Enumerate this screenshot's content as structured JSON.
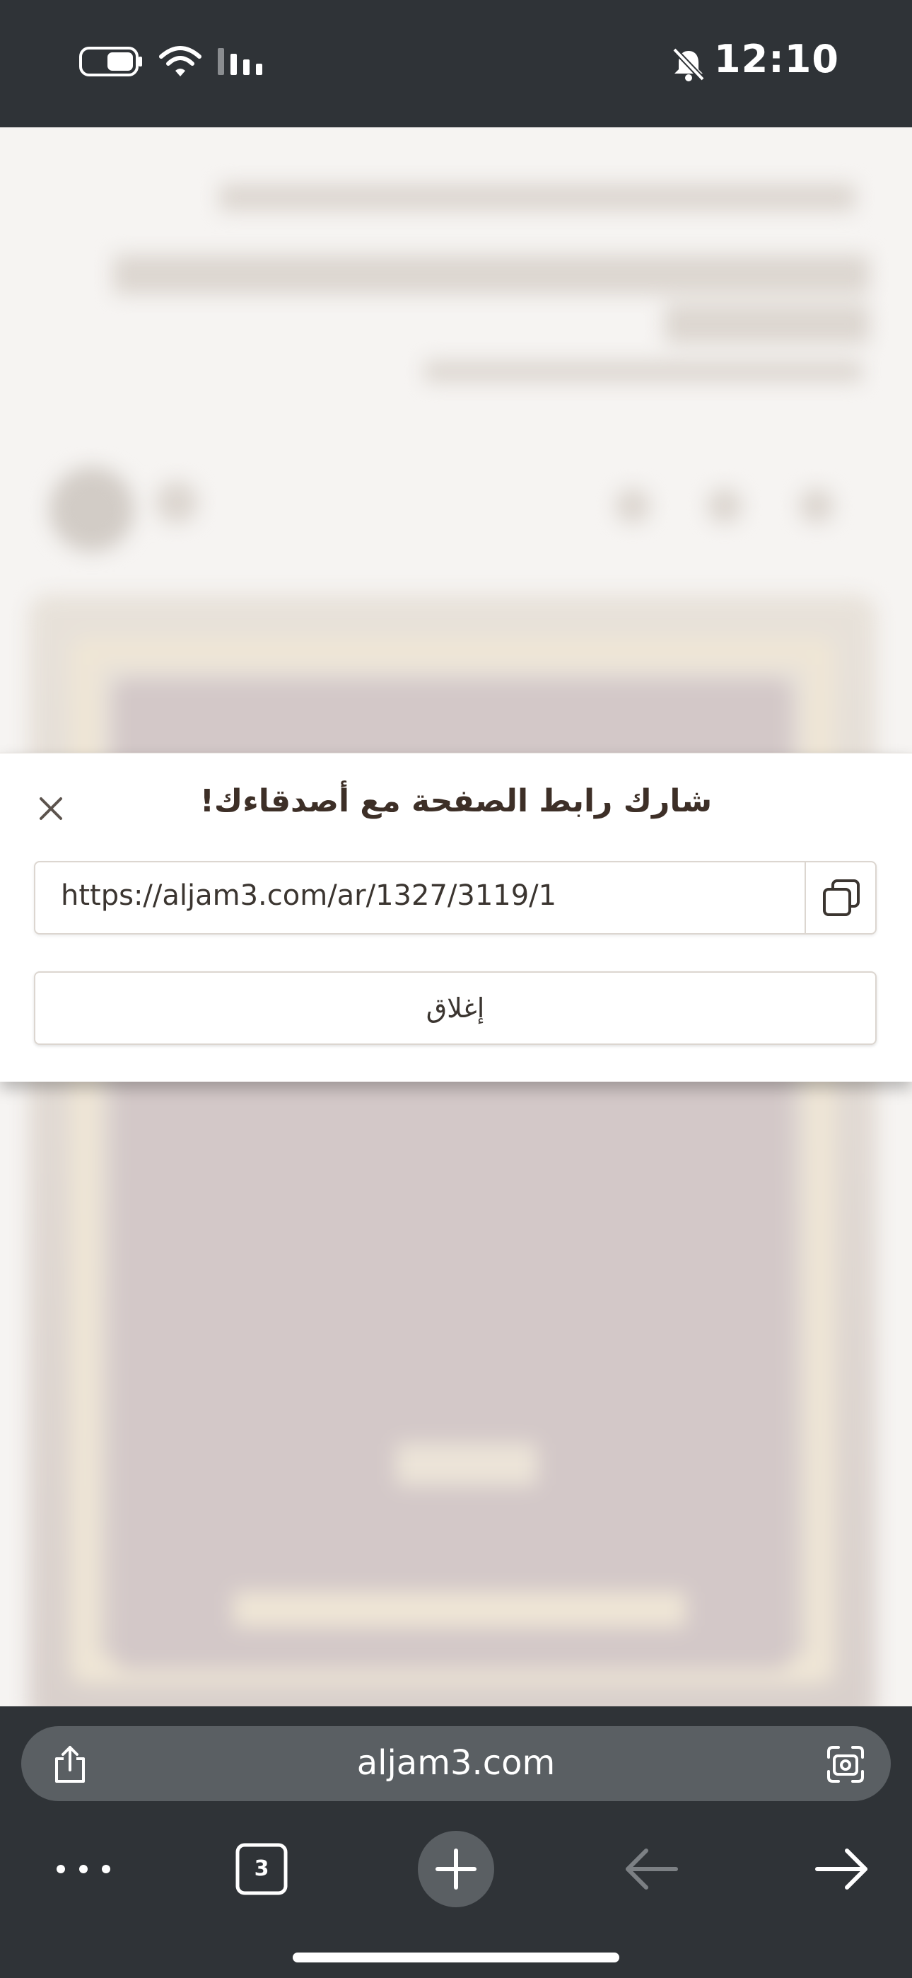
{
  "status_bar": {
    "time": "12:10",
    "icons": [
      "battery-icon",
      "wifi-icon",
      "signal-icon",
      "bell-slash-icon"
    ]
  },
  "share_dialog": {
    "title": "شارك رابط الصفحة مع أصدقاءك!",
    "url_value": "https://aljam3.com/ar/1327/3119/1",
    "close_label": "إغلاق",
    "icons": [
      "close-icon",
      "copy-icon"
    ]
  },
  "browser": {
    "address": "aljam3.com",
    "tab_count": "3",
    "icons": [
      "share-icon",
      "lens-icon",
      "more-icon",
      "tabs-icon",
      "new-tab-icon",
      "back-icon",
      "forward-icon"
    ]
  }
}
